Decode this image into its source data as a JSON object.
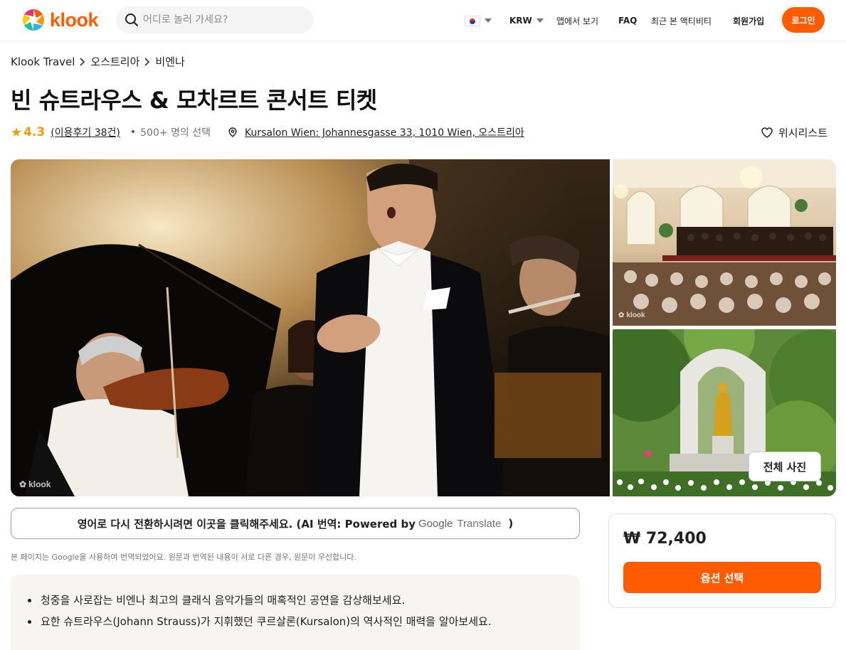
{
  "header": {
    "logo_text": "klook",
    "search_placeholder": "어디로 놀러 가세요?",
    "currency": "KRW",
    "app_link": "앱에서 보기",
    "faq": "FAQ",
    "recent": "최근 본 액티비티",
    "signup": "회원가입",
    "login": "로그인"
  },
  "breadcrumb": [
    "Klook Travel",
    "오스트리아",
    "비엔나"
  ],
  "activity": {
    "title": "빈 슈트라우스 & 모차르트 콘서트 티켓",
    "rating": "4.3",
    "reviews": "(이용후기 38건)",
    "booked": "500+ 명의 선택",
    "location": "Kursalon Wien: Johannesgasse 33, 1010 Wien, 오스트리아",
    "wishlist": "위시리스트"
  },
  "gallery": {
    "watermark": "klook",
    "all_photos": "전체 사진"
  },
  "translate": {
    "bar_text": "영어로 다시 전환하시려면 이곳을 클릭해주세요. (AI 번역: Powered by",
    "google": "Google",
    "translate_word": "Translate",
    "close_paren": ")",
    "note": "본 페이지는 Google을 사용하여 번역되었어요. 원문과 번역된 내용이 서로 다른 경우, 원문이 우선합니다."
  },
  "highlights": [
    "청중을 사로잡는 비엔나 최고의 클래식 음악가들의 매혹적인 공연을 감상해보세요.",
    "요한 슈트라우스(Johann Strauss)가 지휘했던 쿠르살론(Kursalon)의 역사적인 매력을 알아보세요."
  ],
  "booking": {
    "price": "₩ 72,400",
    "option_button": "옵션 선택"
  },
  "colors": {
    "brand": "#ff5b00",
    "rating": "#f09b0a"
  }
}
